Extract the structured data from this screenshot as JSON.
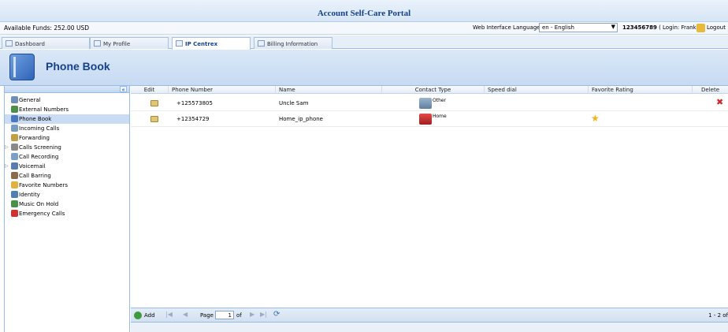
{
  "app": {
    "title": "Account Self-Care Portal"
  },
  "infobar": {
    "funds": "Available Funds: 252.00 USD",
    "lang_label": "Web Interface Language:",
    "lang_value": "en - English",
    "account_number": "123456789",
    "login": "( Login: Frank )",
    "logout": "Logout"
  },
  "tabs": [
    {
      "label": "Dashboard",
      "icon": "dashboard-icon"
    },
    {
      "label": "My Profile",
      "icon": "profile-icon"
    },
    {
      "label": "IP Centrex",
      "icon": "ip-centrex-icon",
      "active": true
    },
    {
      "label": "Billing Information",
      "icon": "billing-icon"
    }
  ],
  "banner": {
    "title": "Phone Book",
    "icon": "phone-book-icon"
  },
  "sidebar": {
    "collapse": "«",
    "items": [
      {
        "label": "General",
        "color": "#6e8fb8"
      },
      {
        "label": "External Numbers",
        "color": "#4b8f4b"
      },
      {
        "label": "Phone Book",
        "color": "#4a77c0",
        "selected": true
      },
      {
        "label": "Incoming Calls",
        "color": "#7a9ac0"
      },
      {
        "label": "Forwarding",
        "color": "#c0a040"
      },
      {
        "label": "Calls Screening",
        "color": "#8a8a8a",
        "expandable": true
      },
      {
        "label": "Call Recording",
        "color": "#7aa0c8"
      },
      {
        "label": "Voicemail",
        "color": "#5a7ab0",
        "expandable": true
      },
      {
        "label": "Call Barring",
        "color": "#8a6a4a"
      },
      {
        "label": "Favorite Numbers",
        "color": "#e0b040"
      },
      {
        "label": "Identity",
        "color": "#5080b0"
      },
      {
        "label": "Music On Hold",
        "color": "#4a8f4a"
      },
      {
        "label": "Emergency Calls",
        "color": "#d03030"
      }
    ]
  },
  "grid": {
    "columns": [
      "Edit",
      "Phone Number",
      "Name",
      "Contact Type",
      "Speed dial",
      "Favorite Rating",
      "Delete"
    ],
    "rows": [
      {
        "phone": "+125573805",
        "name": "Uncle Sam",
        "contact_type": "Other",
        "speed_dial": "",
        "favorite": false,
        "deletable": true
      },
      {
        "phone": "+12354729",
        "name": "Home_ip_phone",
        "contact_type": "Home",
        "speed_dial": "",
        "favorite": true,
        "deletable": false
      }
    ]
  },
  "pager": {
    "add": "Add",
    "page_label": "Page",
    "page_value": "1",
    "of": "of",
    "count": "1 - 2 of"
  }
}
